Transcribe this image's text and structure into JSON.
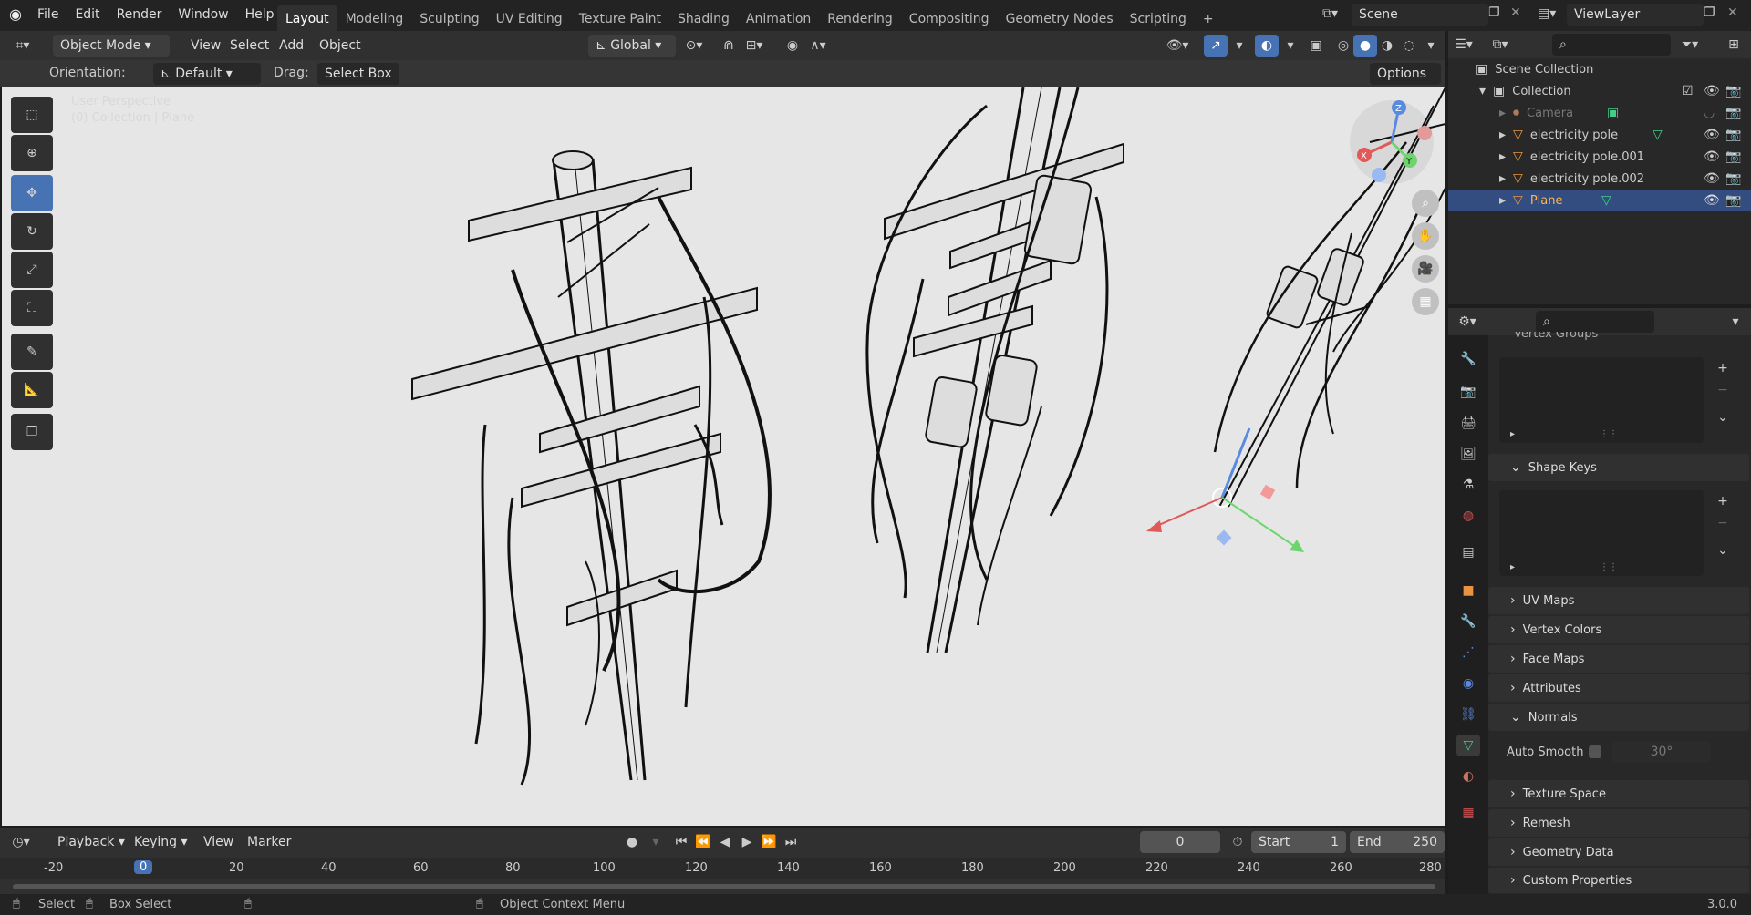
{
  "topbar": {
    "menus": [
      "File",
      "Edit",
      "Render",
      "Window",
      "Help"
    ],
    "tabs": [
      "Layout",
      "Modeling",
      "Sculpting",
      "UV Editing",
      "Texture Paint",
      "Shading",
      "Animation",
      "Rendering",
      "Compositing",
      "Geometry Nodes",
      "Scripting"
    ],
    "active_tab": "Layout",
    "scene": "Scene",
    "view_layer": "ViewLayer"
  },
  "view3d": {
    "mode": "Object Mode",
    "menus": [
      "View",
      "Select",
      "Add",
      "Object"
    ],
    "transform_orientation": "Global",
    "orientation_label": "Orientation:",
    "orientation_value": "Default",
    "drag_label": "Drag:",
    "drag_value": "Select Box",
    "options": "Options",
    "overlay_title": "User Perspective",
    "overlay_subtitle": "(0) Collection | Plane"
  },
  "outliner": {
    "root": "Scene Collection",
    "collection": "Collection",
    "items": [
      {
        "name": "Camera",
        "selected": false
      },
      {
        "name": "electricity pole",
        "selected": false
      },
      {
        "name": "electricity pole.001",
        "selected": false
      },
      {
        "name": "electricity pole.002",
        "selected": false
      },
      {
        "name": "Plane",
        "selected": true
      }
    ]
  },
  "properties": {
    "partial_header": "Vertex Groups",
    "panels": [
      "Shape Keys",
      "UV Maps",
      "Vertex Colors",
      "Face Maps",
      "Attributes",
      "Normals",
      "Texture Space",
      "Remesh",
      "Geometry Data",
      "Custom Properties"
    ],
    "auto_smooth_label": "Auto Smooth",
    "auto_smooth_angle": "30°"
  },
  "timeline": {
    "menus": [
      "Playback",
      "Keying",
      "View",
      "Marker"
    ],
    "current_frame": "0",
    "start_label": "Start",
    "start": "1",
    "end_label": "End",
    "end": "250",
    "ruler": [
      "-20",
      "0",
      "20",
      "40",
      "60",
      "80",
      "100",
      "120",
      "140",
      "160",
      "180",
      "200",
      "220",
      "240",
      "260",
      "280"
    ]
  },
  "status": {
    "select": "Select",
    "box_select": "Box Select",
    "context_menu": "Object Context Menu",
    "version": "3.0.0"
  },
  "colors": {
    "accent": "#4772b3",
    "selected_row": "#334d80",
    "viewport_bg": "#e6e6e6"
  }
}
